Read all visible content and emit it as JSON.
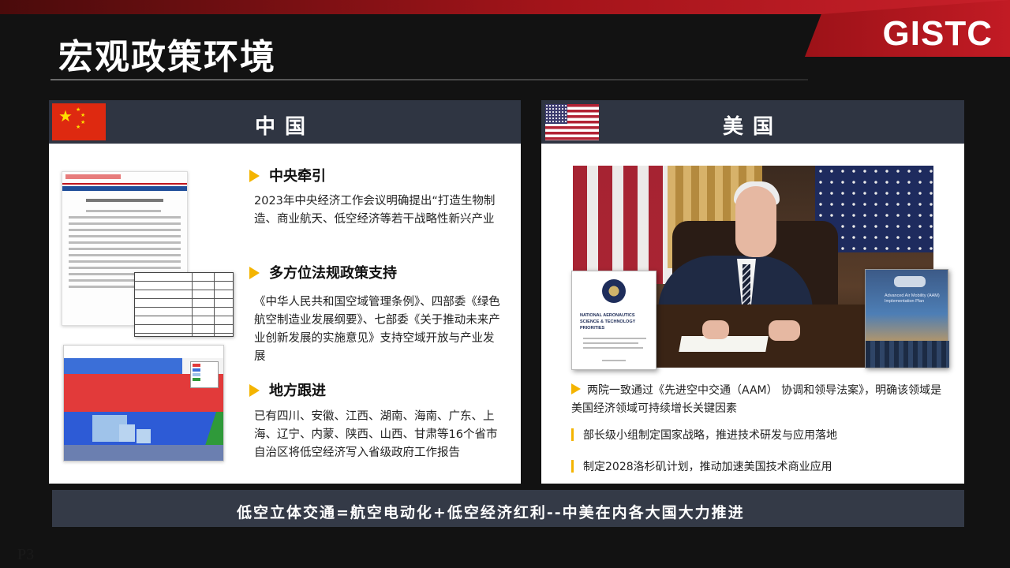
{
  "slide": {
    "title": "宏观政策环境",
    "logo": "GISTC",
    "page_number": "P3"
  },
  "left_panel": {
    "header": "中国",
    "flag_icon": "china-flag-icon",
    "sections": [
      {
        "heading": "中央牵引",
        "body": "2023年中央经济工作会议明确提出“打造生物制造、商业航天、低空经济等若干战略性新兴产业"
      },
      {
        "heading": "多方位法规政策支持",
        "body": "《中华人民共和国空域管理条例》、四部委《绿色航空制造业发展纲要》、七部委《关于推动未来产业创新发展的实施意见》支持空域开放与产业发展"
      },
      {
        "heading": "地方跟进",
        "body": "已有四川、安徽、江西、湖南、海南、广东、上海、辽宁、内蒙、陕西、山西、甘肃等16个省市自治区将低空经济写入省级政府工作报告"
      }
    ]
  },
  "right_panel": {
    "header": "美国",
    "flag_icon": "usa-flag-icon",
    "bullets": [
      {
        "text": "两院一致通过《先进空中交通（AAM） 协调和领导法案》，明确该领域是美国经济领域可持续增长关键因素"
      },
      {
        "text": "部长级小组制定国家战略，推进技术研发与应用落地"
      },
      {
        "text": "制定2028洛杉矶计划，推动加速美国技术商业应用"
      }
    ]
  },
  "footer": {
    "banner": "低空立体交通=航空电动化+低空经济红利--中美在内各大国大力推进"
  },
  "colors": {
    "accent_red": "#c21b24",
    "header_bar": "#2f3542",
    "bullet_yellow": "#f4b400",
    "background": "#121212"
  }
}
